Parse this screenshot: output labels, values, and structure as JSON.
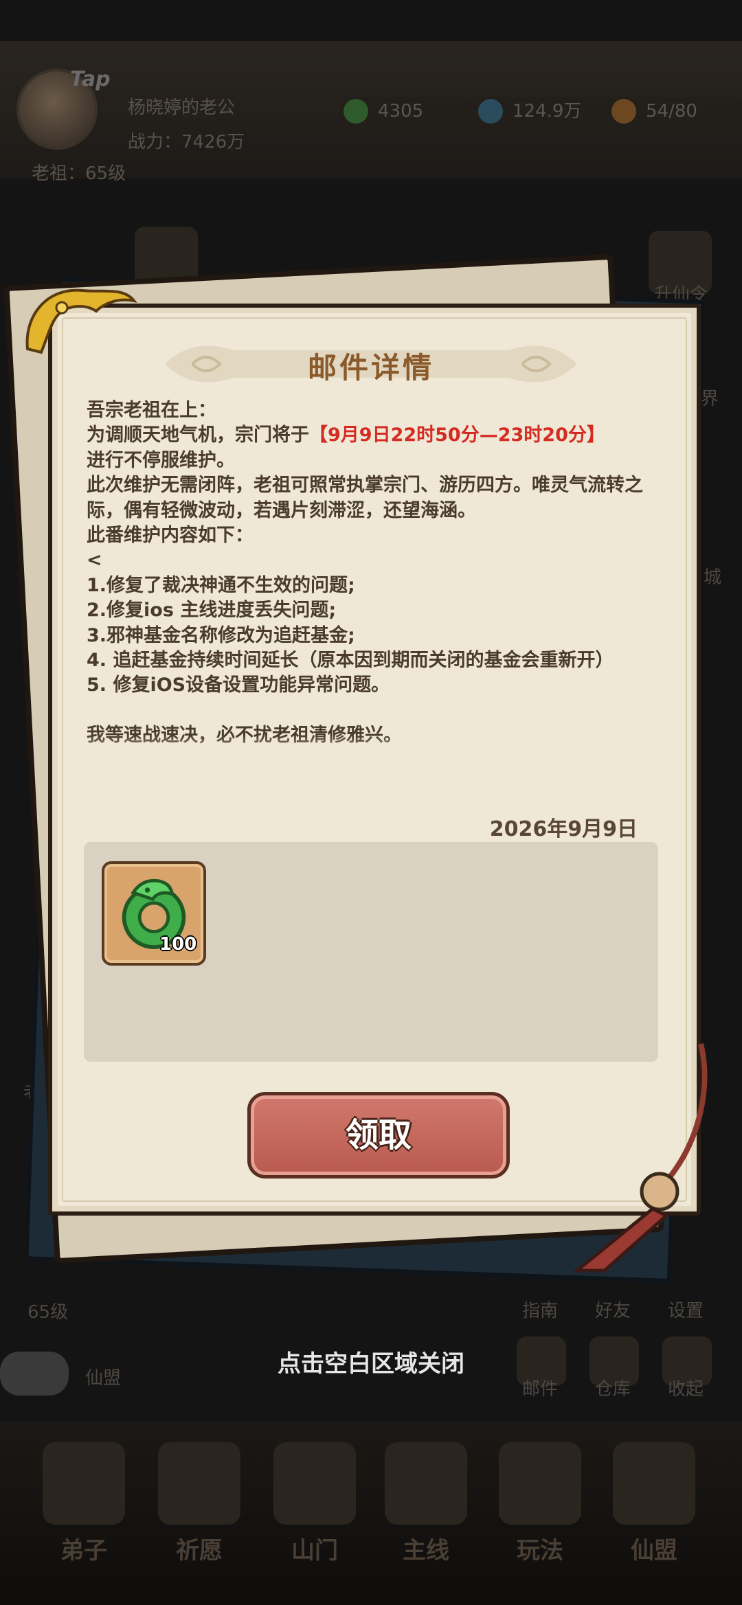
{
  "background": {
    "player_name": "杨晓婷的老公",
    "power": "战力：7426万",
    "level": "老祖：65级",
    "tap_label": "Tap",
    "resources": [
      {
        "value": "4305",
        "icon": "jade-coin-icon",
        "color": "#3f7f3a"
      },
      {
        "value": "124.9万",
        "icon": "spirit-stone-icon",
        "color": "#3b6c86"
      },
      {
        "value": "54/80",
        "icon": "peach-icon",
        "color": "#a76a2a"
      }
    ],
    "side_labels": {
      "top_right": "升仙令",
      "right_mid1": "界",
      "right_mid2": "城",
      "left_mid": "老"
    },
    "bottom_left_level": "65级",
    "alliance_label": "仙盟",
    "right_buttons": [
      "指南",
      "好友",
      "设置"
    ],
    "right_buttons2": [
      "邮件",
      "仓库",
      "收起"
    ],
    "nav": [
      "弟子",
      "祈愿",
      "山门",
      "主线",
      "玩法",
      "仙盟"
    ]
  },
  "mail": {
    "title": "邮件详情",
    "greeting": "吾宗老祖在上：",
    "line1_prefix": "为调顺天地气机，宗门将于",
    "line1_time": "【9月9日22时50分—23时20分】",
    "line2": "进行不停服维护。",
    "line3": "此次维护无需闭阵，老祖可照常执掌宗门、游历四方。唯灵气流转之际，偶有轻微波动，若遇片刻滞涩，还望海涵。",
    "line4": "此番维护内容如下：",
    "line5": "<",
    "items": [
      "1.修复了裁决神通不生效的问题;",
      "2.修复ios 主线进度丢失问题;",
      "3.邪神基金名称修改为追赶基金;",
      "4. 追赶基金持续时间延长（原本因到期而关闭的基金会重新开）",
      "5. 修复iOS设备设置功能异常问题。"
    ],
    "closing": "我等速战速决，必不扰老祖清修雅兴。",
    "date": "2026年9月9日",
    "reward": {
      "icon": "jade-dragon-icon",
      "count": "100"
    },
    "claim_label": "领取"
  },
  "close_hint": "点击空白区域关闭",
  "colors": {
    "title": "#8b5a2b",
    "highlight": "#d42b22",
    "button": "#c8675b",
    "paper": "#efe8d6"
  }
}
